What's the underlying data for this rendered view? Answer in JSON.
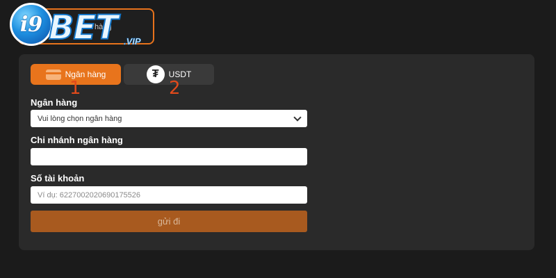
{
  "header": {
    "logo_text": "i9BET",
    "logo_badge": "i9",
    "logo_main": "BET",
    "logo_suffix": ".VIP",
    "behind_plus": "+",
    "behind_text": "hàng"
  },
  "tabs": [
    {
      "label": "Ngân hàng",
      "icon": "bank-card-icon",
      "active": true,
      "marker": "1"
    },
    {
      "label": "USDT",
      "icon": "tether-icon",
      "active": false,
      "marker": "2"
    }
  ],
  "form": {
    "bank": {
      "label": "Ngân hàng",
      "value": "Vui lòng chọn ngân hàng"
    },
    "branch": {
      "label": "Chi nhánh ngân hàng",
      "value": ""
    },
    "account": {
      "label": "Số tài khoản",
      "placeholder": "Ví dụ:  6227002020690175526"
    },
    "submit_label": "gửi đi"
  },
  "colors": {
    "accent": "#e8741c",
    "submit": "#a85a1f",
    "marker": "#e24a1b",
    "panel": "#2a2a2a",
    "background": "#1b1b1b"
  }
}
